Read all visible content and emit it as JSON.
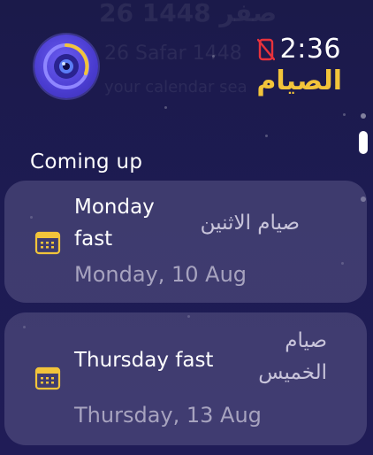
{
  "ghost": {
    "line1": "26 صفر 1448",
    "line2": "26 Safar 1448",
    "line3": "your calendar sea"
  },
  "header": {
    "app_icon": "timer-lens-icon",
    "status_icon": "phone-disconnected-icon",
    "time": "2:36",
    "title": "الصيام"
  },
  "section": {
    "label": "Coming up"
  },
  "events": [
    {
      "name": "Monday fast",
      "name_ar": "صيام الاثنين",
      "date": "Monday, 10 Aug",
      "icon": "calendar-icon"
    },
    {
      "name": "Thursday fast",
      "name_ar": "صيام الخميس",
      "date": "Thursday, 13 Aug",
      "icon": "calendar-icon"
    }
  ],
  "colors": {
    "accent": "#f2c43a",
    "status_red": "#e8323c",
    "background": "#1d1b52"
  }
}
